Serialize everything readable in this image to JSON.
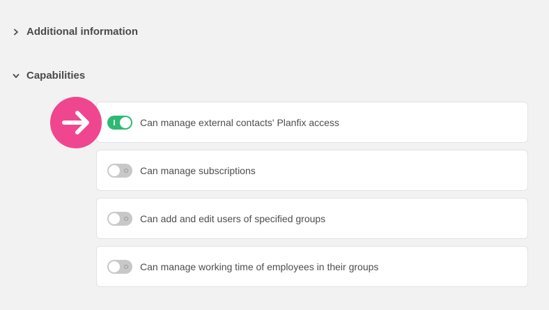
{
  "sections": {
    "additional": {
      "label": "Additional information",
      "expanded": false
    },
    "capabilities": {
      "label": "Capabilities",
      "expanded": true
    }
  },
  "capabilities": [
    {
      "label": "Can manage external contacts' Planfix access",
      "enabled": true
    },
    {
      "label": "Can manage subscriptions",
      "enabled": false
    },
    {
      "label": "Can add and edit users of specified groups",
      "enabled": false
    },
    {
      "label": "Can manage working time of employees in their groups",
      "enabled": false
    }
  ],
  "colors": {
    "toggle_on": "#2dba72",
    "toggle_off": "#c8c8c8",
    "pointer_badge": "#f0468f"
  },
  "icons": {
    "collapsed": "chevron-right-icon",
    "expanded": "chevron-down-icon",
    "pointer": "arrow-right-icon"
  }
}
